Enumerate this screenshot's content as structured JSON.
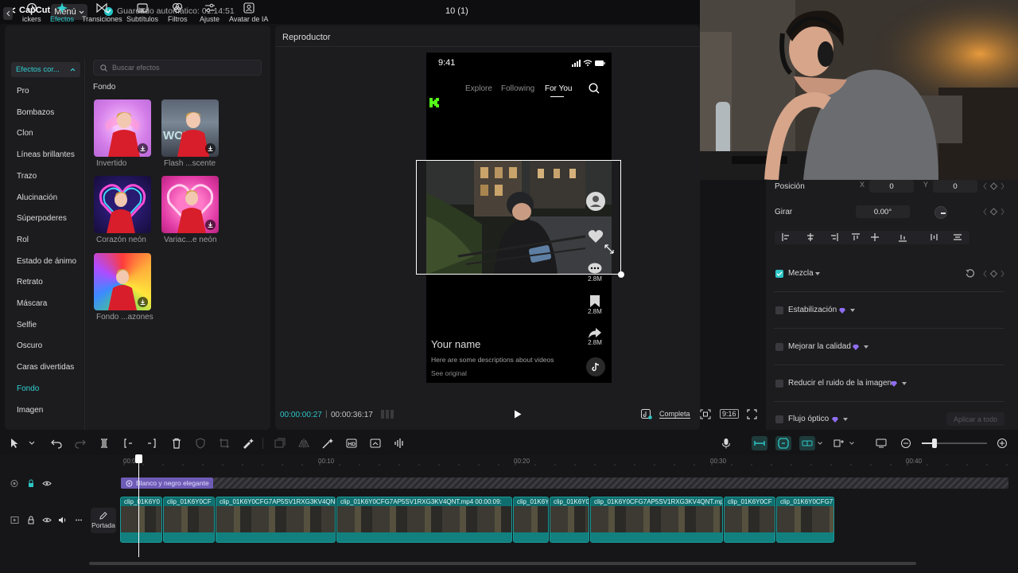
{
  "app": {
    "logo_text": "CapCut",
    "menu_label": "Menú",
    "autosave_text": "Guardado automático: 01:14:51",
    "project_title": "10 (1)"
  },
  "left_panel": {
    "tabs": [
      {
        "label": "ickers",
        "icon": "sticker-icon"
      },
      {
        "label": "Efectos",
        "icon": "sparkle-icon",
        "active": true
      },
      {
        "label": "Transiciones",
        "icon": "bowtie-icon"
      },
      {
        "label": "Subtítulos",
        "icon": "caption-icon"
      },
      {
        "label": "Filtros",
        "icon": "filter-icon"
      },
      {
        "label": "Ajuste",
        "icon": "sliders-icon"
      },
      {
        "label": "Avatar de IA",
        "icon": "avatar-icon"
      }
    ],
    "category_header": "Efectos cor...",
    "categories": [
      "Pro",
      "Bombazos",
      "Clon",
      "Líneas brillantes",
      "Trazo",
      "Alucinación",
      "Súperpoderes",
      "Rol",
      "Estado de ánimo",
      "Retrato",
      "Máscara",
      "Selfie",
      "Oscuro",
      "Caras divertidas",
      "Fondo",
      "Imagen"
    ],
    "active_category": "Fondo",
    "search_placeholder": "Buscar efectos",
    "section_title": "Fondo",
    "effects": [
      {
        "label": "Invertido"
      },
      {
        "label": "Flash ...scente"
      },
      {
        "label": "Corazón neón"
      },
      {
        "label": "Variac...e neón"
      },
      {
        "label": "Fondo ...azones"
      }
    ]
  },
  "player": {
    "title": "Reproductor",
    "phone": {
      "time": "9:41",
      "nav": [
        "Explore",
        "Following",
        "For You"
      ],
      "counts": [
        "2.8M",
        "2.8M",
        "2.8M"
      ],
      "name": "Your name",
      "description": "Here are some descriptions about videos",
      "see_original": "See original"
    },
    "time_current": "00:00:00:27",
    "time_total": "00:00:36:17",
    "ratio_label": "Completa",
    "aspect": "9:16"
  },
  "right_panel": {
    "position_label": "Posición",
    "x_label": "X",
    "x_value": "0",
    "y_label": "Y",
    "y_value": "0",
    "rotate_label": "Girar",
    "rotate_value": "0.00°",
    "mix_label": "Mezcla",
    "stabilization_label": "Estabilización",
    "quality_label": "Mejorar la calidad",
    "noise_label": "Reducir el ruido de la imagen",
    "flow_label": "Flujo óptico",
    "apply_all": "Aplicar a todo"
  },
  "timeline": {
    "ticks": [
      "00:00",
      "00:10",
      "00:20",
      "00:30",
      "00:40"
    ],
    "effect_chip": "Blanco y negro elegante",
    "cover_label": "Portada",
    "clips": [
      {
        "name": "clip_01K6Y0"
      },
      {
        "name": "clip_01K6Y0CF"
      },
      {
        "name": "clip_01K6Y0CFG7AP5SV1RXG3KV4QN"
      },
      {
        "name": "clip_01K6Y0CFG7AP5SV1RXG3KV4QNT.mp4  00:00:09:"
      },
      {
        "name": "clip_01K6Y"
      },
      {
        "name": "clip_01K6Y0"
      },
      {
        "name": "clip_01K6Y0CFG7AP5SV1RXG3KV4QNT.mp"
      },
      {
        "name": "clip_01K6Y0CF"
      },
      {
        "name": "clip_01K6Y0CFG7"
      }
    ]
  },
  "colors": {
    "accent": "#2ec6c6",
    "effect_purple": "#6d5bb6",
    "tiktok_green": "#25f4ee"
  }
}
